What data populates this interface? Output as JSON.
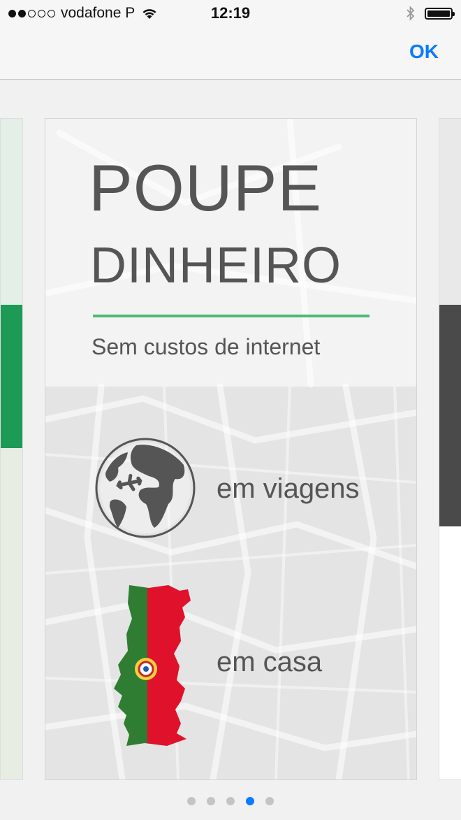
{
  "status_bar": {
    "carrier": "vodafone P",
    "time": "12:19",
    "signal_bars_filled": 2,
    "signal_bars_total": 5,
    "icons": [
      "wifi-icon",
      "bluetooth-icon",
      "battery-icon"
    ]
  },
  "nav": {
    "ok_label": "OK",
    "accent_color": "#0a7aff"
  },
  "card": {
    "title_line1": "POUPE",
    "title_line2": "DINHEIRO",
    "subtitle": "Sem custos de internet",
    "rule_color": "#4bbb72",
    "features": [
      {
        "icon": "globe-airplane-icon",
        "label": "em viagens"
      },
      {
        "icon": "portugal-flag-map-icon",
        "label": "em casa"
      }
    ]
  },
  "pagination": {
    "total": 5,
    "active_index": 3
  }
}
